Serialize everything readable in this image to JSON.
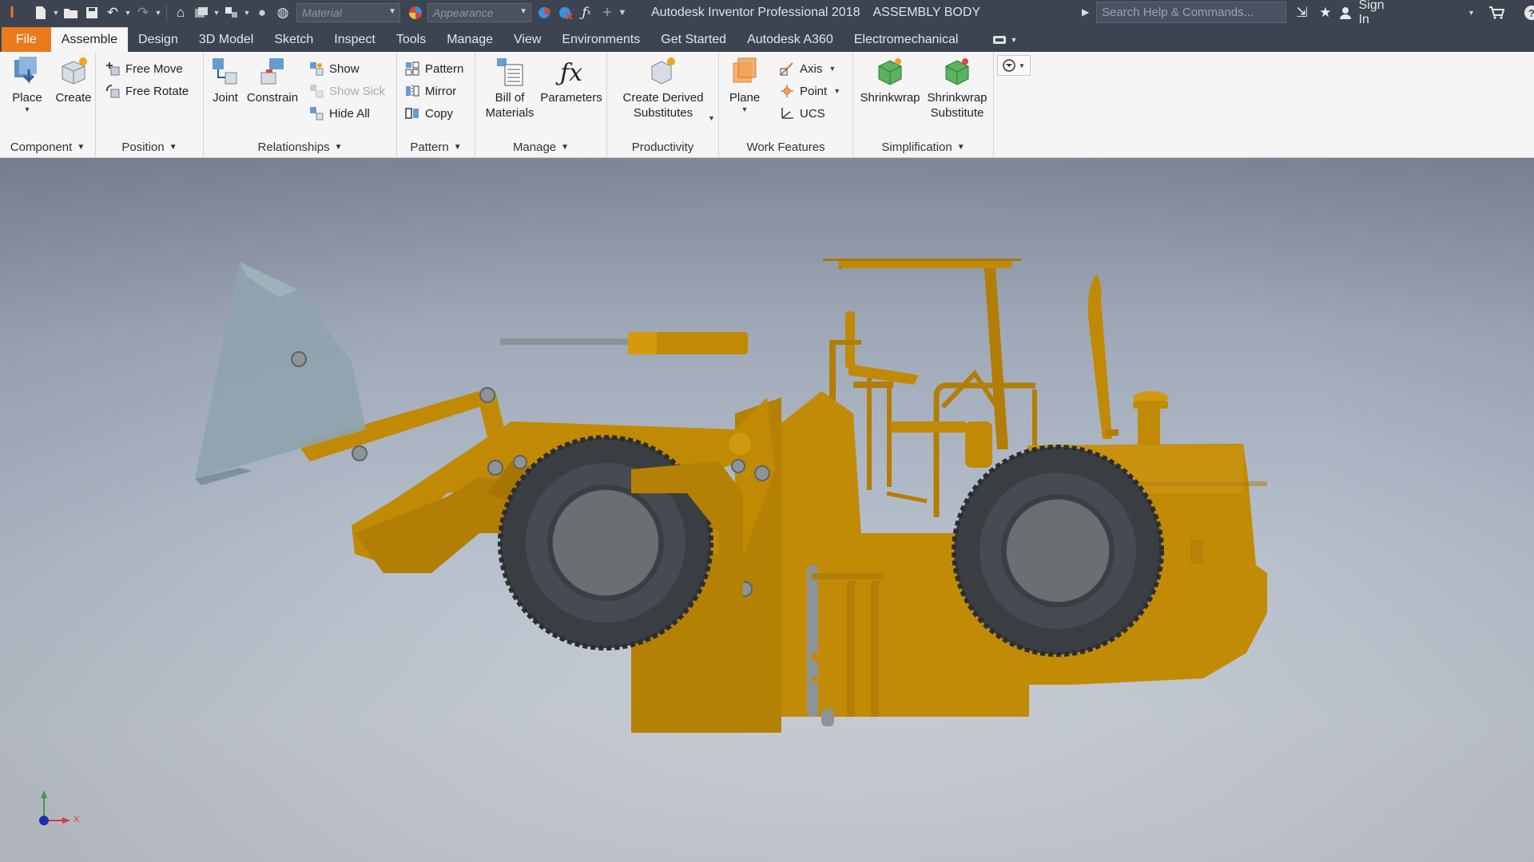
{
  "app": {
    "title": "Autodesk Inventor Professional 2018",
    "document": "ASSEMBLY BODY"
  },
  "quick_access": {
    "material_placeholder": "Material",
    "appearance_placeholder": "Appearance"
  },
  "search": {
    "placeholder": "Search Help & Commands..."
  },
  "user": {
    "sign_in": "Sign In"
  },
  "tabs": [
    {
      "label": "File"
    },
    {
      "label": "Assemble"
    },
    {
      "label": "Design"
    },
    {
      "label": "3D Model"
    },
    {
      "label": "Sketch"
    },
    {
      "label": "Inspect"
    },
    {
      "label": "Tools"
    },
    {
      "label": "Manage"
    },
    {
      "label": "View"
    },
    {
      "label": "Environments"
    },
    {
      "label": "Get Started"
    },
    {
      "label": "Autodesk A360"
    },
    {
      "label": "Electromechanical"
    }
  ],
  "ribbon": {
    "component": {
      "label": "Component",
      "place": "Place",
      "create": "Create"
    },
    "position": {
      "label": "Position",
      "free_move": "Free Move",
      "free_rotate": "Free Rotate"
    },
    "relationships": {
      "label": "Relationships",
      "joint": "Joint",
      "constrain": "Constrain",
      "show": "Show",
      "show_sick": "Show Sick",
      "hide_all": "Hide All"
    },
    "pattern": {
      "label": "Pattern",
      "pattern": "Pattern",
      "mirror": "Mirror",
      "copy": "Copy"
    },
    "manage": {
      "label": "Manage",
      "bom_line1": "Bill of",
      "bom_line2": "Materials",
      "parameters": "Parameters"
    },
    "productivity": {
      "label": "Productivity",
      "derived_line1": "Create Derived",
      "derived_line2": "Substitutes"
    },
    "work_features": {
      "label": "Work Features",
      "plane": "Plane",
      "axis": "Axis",
      "point": "Point",
      "ucs": "UCS"
    },
    "simplification": {
      "label": "Simplification",
      "shrinkwrap": "Shrinkwrap",
      "sub_line1": "Shrinkwrap",
      "sub_line2": "Substitute"
    }
  },
  "viewport": {
    "triad_x_label": "X",
    "model_name": "wheel-loader",
    "colors": {
      "body": "#c08a05",
      "body_shade": "#a87808",
      "tire": "#3a3d42",
      "rim": "#6b6e73",
      "bucket": "#8fa3ae",
      "pin": "#8f9499"
    }
  },
  "colors": {
    "file_tab": "#e97b1d",
    "titlebar": "#3c4452",
    "ribbon": "#f5f5f5"
  }
}
